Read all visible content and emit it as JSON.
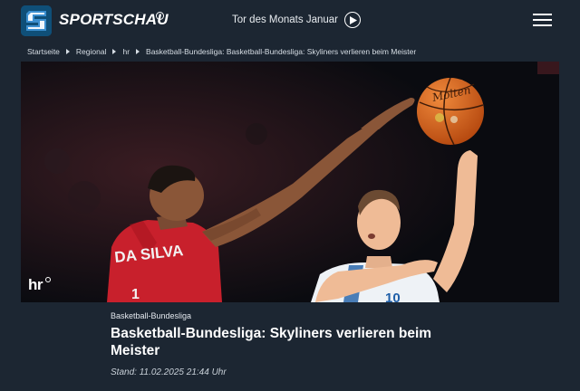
{
  "header": {
    "brand": "SPORTSCHAU",
    "promo_label": "Tor des Monats Januar",
    "icons": [
      "sportschau-logo-icon",
      "play-icon",
      "menu-icon"
    ]
  },
  "breadcrumb": [
    "Startseite",
    "Regional",
    "hr",
    "Basketball-Bundesliga: Basketball-Bundesliga: Skyliners verlieren beim Meister"
  ],
  "hero": {
    "jersey_name": "DA SILVA",
    "jersey_number": "1",
    "jersey_number_right": "10",
    "broadcaster_logo": "hr"
  },
  "article": {
    "topline": "Basketball-Bundesliga",
    "headline": "Basketball-Bundesliga: Skyliners verlieren beim Meister",
    "stand": "Stand: 11.02.2025 21:44 Uhr"
  },
  "colors": {
    "background": "#1c2632",
    "logo_blue": "#10547f",
    "jersey_red": "#c8202c"
  }
}
